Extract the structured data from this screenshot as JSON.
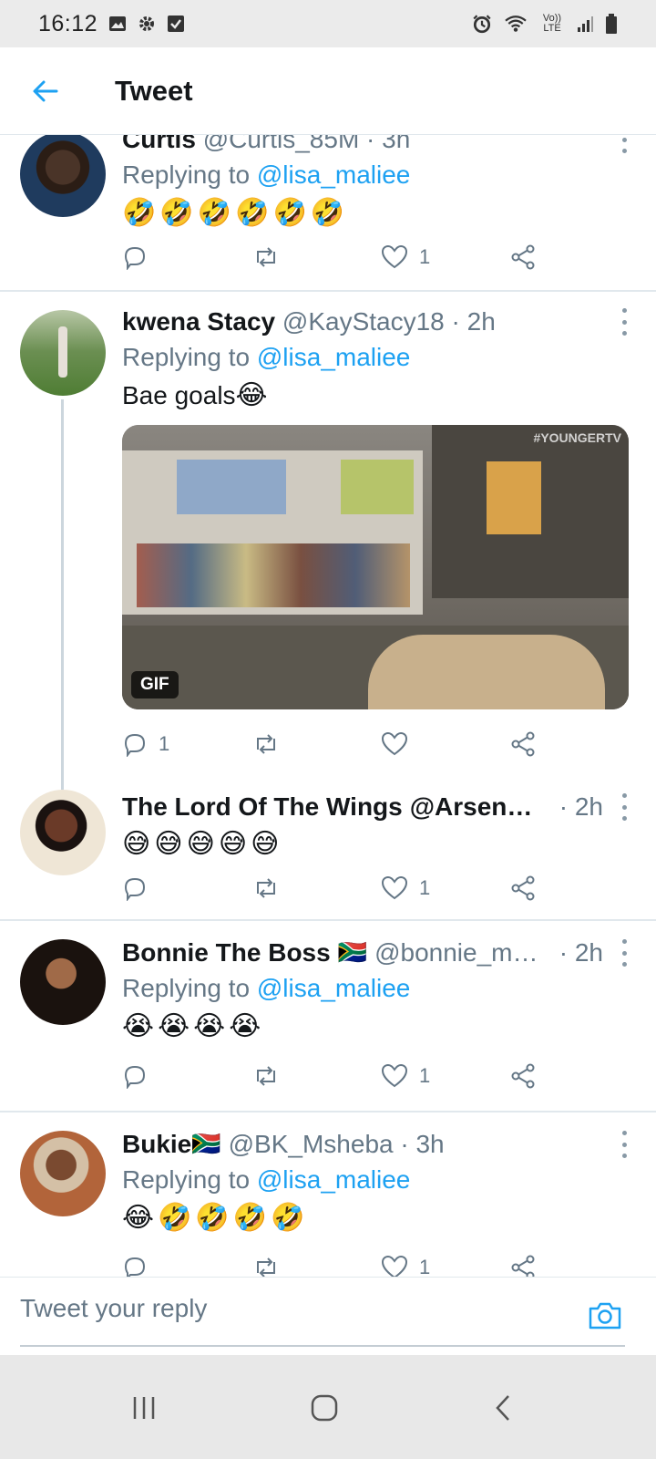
{
  "status_bar": {
    "time": "16:12",
    "left_icons": [
      "image-icon",
      "gear-icon",
      "check-box-icon"
    ],
    "right_icons": [
      "alarm-icon",
      "wifi-icon",
      "volte-icon",
      "signal-icon",
      "battery-icon"
    ],
    "volte_label": "Vo)) LTE"
  },
  "app_bar": {
    "title": "Tweet"
  },
  "tweets": [
    {
      "name": "Curtis",
      "handle": "@Curtis_85M · 3h",
      "reply_prefix": "Replying to ",
      "reply_to": "@lisa_maliee",
      "emojis": [
        "🤣",
        "🤣",
        "🤣",
        "🤣",
        "🤣",
        "🤣"
      ],
      "likes": "1"
    },
    {
      "name": "kwena Stacy",
      "handle": "@KayStacy18 · 2h",
      "reply_prefix": "Replying to ",
      "reply_to": "@lisa_maliee",
      "text": "Bae goals",
      "text_emoji": "😂",
      "media_badge": "GIF",
      "media_watermark": "#YOUNGERTV",
      "replies": "1"
    },
    {
      "name": "The Lord Of The Wings",
      "handle": "@Arsen…",
      "time": "· 2h",
      "emojis": [
        "😅",
        "😅",
        "😅",
        "😅",
        "😅"
      ],
      "likes": "1"
    },
    {
      "name": "Bonnie The Boss",
      "flag": "🇿🇦",
      "handle": "@bonnie_m…",
      "time": "· 2h",
      "reply_prefix": "Replying to ",
      "reply_to": "@lisa_maliee",
      "emojis": [
        "😭",
        "😭",
        "😭",
        "😭"
      ],
      "likes": "1"
    },
    {
      "name": "Bukie",
      "flag": "🇿🇦",
      "handle": "@BK_Msheba · 3h",
      "reply_prefix": "Replying to ",
      "reply_to": "@lisa_maliee",
      "emojis": [
        "😂",
        "🤣",
        "🤣",
        "🤣",
        "🤣"
      ],
      "likes": "1"
    }
  ],
  "reply_bar": {
    "placeholder": "Tweet your reply"
  },
  "nav_bar": {
    "buttons": [
      "recent-apps",
      "home",
      "back"
    ]
  },
  "colors": {
    "accent": "#1da1f2",
    "text": "#14171a",
    "secondary": "#657786"
  }
}
